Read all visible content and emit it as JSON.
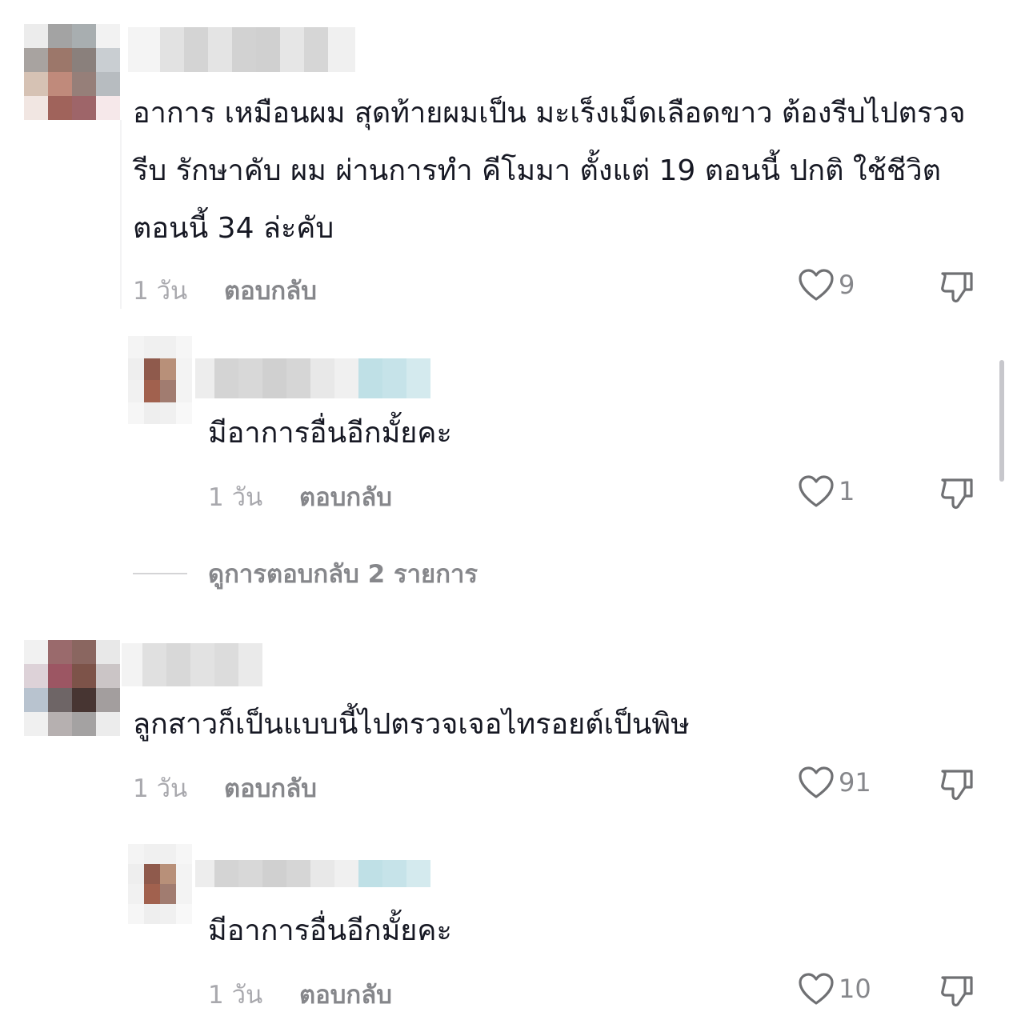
{
  "comments": [
    {
      "text": "อาการ เหมือนผม สุดท้ายผมเป็น มะเร็งเม็ดเลือดขาว ต้องรีบไปตรวจ รีบ รักษาคับ ผม ผ่านการทำ คีโมมา ตั้งแต่ 19 ตอนนี้ ปกติ ใช้ชีวิต ตอนนี้ 34 ล่ะคับ",
      "time": "1 วัน",
      "reply_label": "ตอบกลับ",
      "likes": "9"
    },
    {
      "text": "มีอาการอื่นอีกมั้ยคะ",
      "time": "1 วัน",
      "reply_label": "ตอบกลับ",
      "likes": "1"
    },
    {
      "text": "ลูกสาวก็เป็นแบบนี้ไปตรวจเจอไทรอยต์เป็นพิษ",
      "time": "1 วัน",
      "reply_label": "ตอบกลับ",
      "likes": "91"
    },
    {
      "text": "มีอาการอื่นอีกมั้ยคะ",
      "time": "1 วัน",
      "reply_label": "ตอบกลับ",
      "likes": "10"
    }
  ],
  "view_replies": "ดูการตอบกลับ 2 รายการ",
  "icons": {
    "like": "heart-outline-icon",
    "dislike": "thumbs-down-icon"
  },
  "colors": {
    "text": "#161823",
    "meta": "#86878b",
    "time": "#a8a8ad"
  }
}
